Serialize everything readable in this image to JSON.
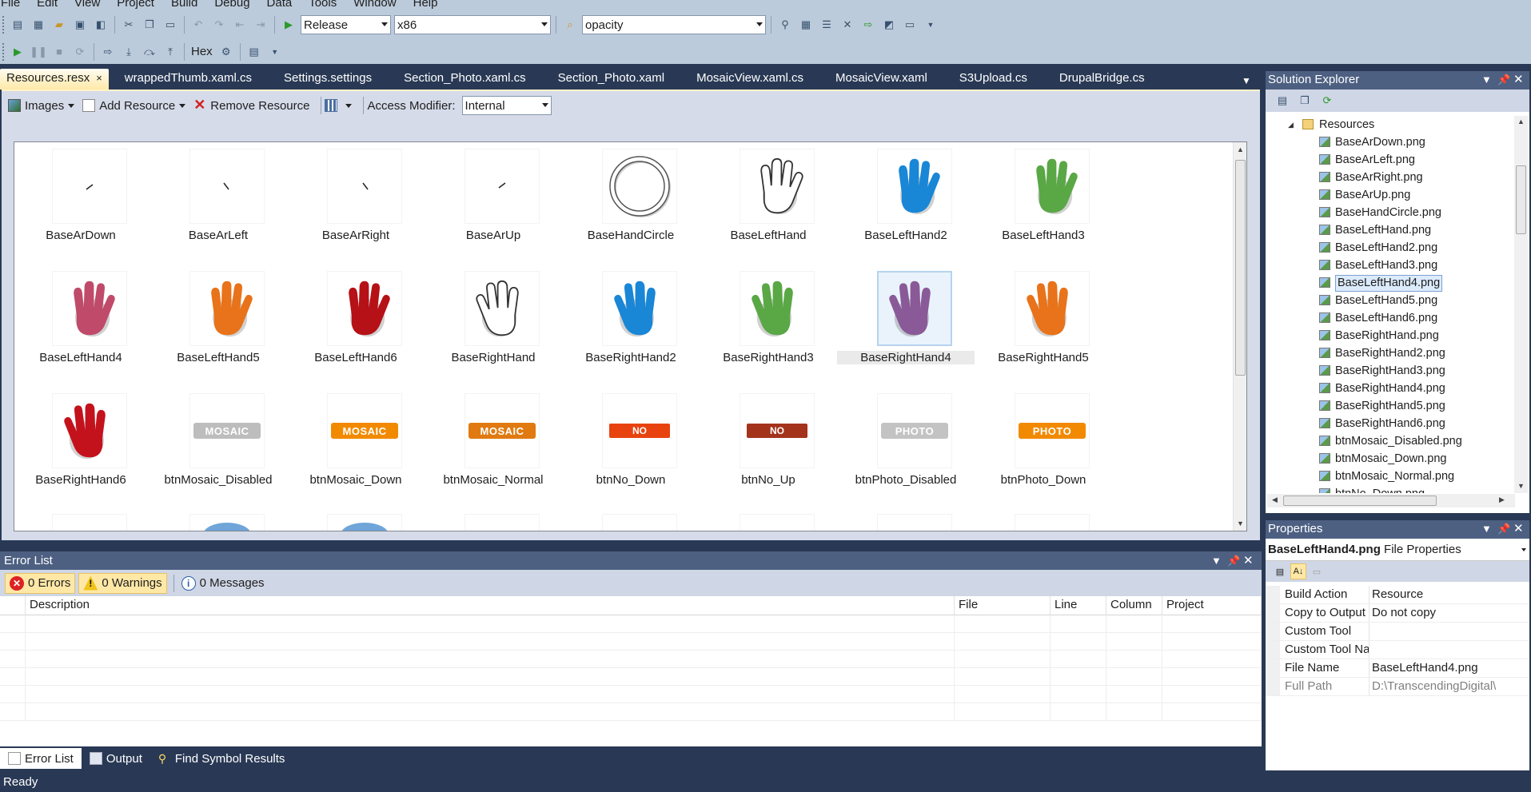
{
  "menu": [
    "File",
    "Edit",
    "View",
    "Project",
    "Build",
    "Debug",
    "Data",
    "Tools",
    "Window",
    "Help"
  ],
  "toolbar": {
    "config": "Release",
    "platform": "x86",
    "find": "opacity",
    "hex_label": "Hex"
  },
  "doc_tabs": [
    {
      "label": "Resources.resx",
      "active": true,
      "close": "×"
    },
    {
      "label": "wrappedThumb.xaml.cs"
    },
    {
      "label": "Settings.settings"
    },
    {
      "label": "Section_Photo.xaml.cs"
    },
    {
      "label": "Section_Photo.xaml"
    },
    {
      "label": "MosaicView.xaml.cs"
    },
    {
      "label": "MosaicView.xaml"
    },
    {
      "label": "S3Upload.cs"
    },
    {
      "label": "DrupalBridge.cs"
    }
  ],
  "resource_toolbar": {
    "images_label": "Images",
    "add_label": "Add Resource",
    "remove_label": "Remove Resource",
    "access_label": "Access Modifier:",
    "access_value": "Internal"
  },
  "resources": [
    {
      "name": "BaseArDown",
      "kind": "arrow",
      "dir": "down"
    },
    {
      "name": "BaseArLeft",
      "kind": "arrow",
      "dir": "left"
    },
    {
      "name": "BaseArRight",
      "kind": "arrow",
      "dir": "right"
    },
    {
      "name": "BaseArUp",
      "kind": "arrow",
      "dir": "up"
    },
    {
      "name": "BaseHandCircle",
      "kind": "circle"
    },
    {
      "name": "BaseLeftHand",
      "kind": "hand",
      "color": "#ffffff",
      "side": "left"
    },
    {
      "name": "BaseLeftHand2",
      "kind": "hand",
      "color": "#1a86d6",
      "side": "left"
    },
    {
      "name": "BaseLeftHand3",
      "kind": "hand",
      "color": "#5aa746",
      "side": "left"
    },
    {
      "name": "BaseLeftHand4",
      "kind": "hand",
      "color": "#c04a6a",
      "side": "left"
    },
    {
      "name": "BaseLeftHand5",
      "kind": "hand",
      "color": "#e8731a",
      "side": "left"
    },
    {
      "name": "BaseLeftHand6",
      "kind": "hand",
      "color": "#b51116",
      "side": "left"
    },
    {
      "name": "BaseRightHand",
      "kind": "hand",
      "color": "#ffffff",
      "side": "right"
    },
    {
      "name": "BaseRightHand2",
      "kind": "hand",
      "color": "#1a86d6",
      "side": "right"
    },
    {
      "name": "BaseRightHand3",
      "kind": "hand",
      "color": "#5aa746",
      "side": "right"
    },
    {
      "name": "BaseRightHand4",
      "kind": "hand",
      "color": "#8a5a98",
      "side": "right",
      "selected": true
    },
    {
      "name": "BaseRightHand5",
      "kind": "hand",
      "color": "#e8731a",
      "side": "right"
    },
    {
      "name": "BaseRightHand6",
      "kind": "hand",
      "color": "#c4121c",
      "side": "right"
    },
    {
      "name": "btnMosaic_Disabled",
      "kind": "badge",
      "text": "MOSAIC",
      "color": "#bdbdbd"
    },
    {
      "name": "btnMosaic_Down",
      "kind": "badge",
      "text": "MOSAIC",
      "color": "#f28a00"
    },
    {
      "name": "btnMosaic_Normal",
      "kind": "badge",
      "text": "MOSAIC",
      "color": "#e07a10"
    },
    {
      "name": "btnNo_Down",
      "kind": "no",
      "text": "NO",
      "color": "#e8430f"
    },
    {
      "name": "btnNo_Up",
      "kind": "no",
      "text": "NO",
      "color": "#a3331b"
    },
    {
      "name": "btnPhoto_Disabled",
      "kind": "badge",
      "text": "PHOTO",
      "color": "#c3c3c3"
    },
    {
      "name": "btnPhoto_Down",
      "kind": "badge",
      "text": "PHOTO",
      "color": "#f28a00"
    }
  ],
  "error_list": {
    "title": "Error List",
    "errors": "0 Errors",
    "warnings": "0 Warnings",
    "messages": "0 Messages",
    "columns": [
      "",
      "Description",
      "File",
      "Line",
      "Column",
      "Project"
    ]
  },
  "bottom_tabs": [
    "Error List",
    "Output",
    "Find Symbol Results"
  ],
  "status": "Ready",
  "solution_explorer": {
    "title": "Solution Explorer",
    "folder": "Resources",
    "files": [
      "BaseArDown.png",
      "BaseArLeft.png",
      "BaseArRight.png",
      "BaseArUp.png",
      "BaseHandCircle.png",
      "BaseLeftHand.png",
      "BaseLeftHand2.png",
      "BaseLeftHand3.png",
      "BaseLeftHand4.png",
      "BaseLeftHand5.png",
      "BaseLeftHand6.png",
      "BaseRightHand.png",
      "BaseRightHand2.png",
      "BaseRightHand3.png",
      "BaseRightHand4.png",
      "BaseRightHand5.png",
      "BaseRightHand6.png",
      "btnMosaic_Disabled.png",
      "btnMosaic_Down.png",
      "btnMosaic_Normal.png",
      "btnNo_Down.png"
    ],
    "selected": "BaseLeftHand4.png"
  },
  "properties": {
    "title": "Properties",
    "object_name": "BaseLeftHand4.png",
    "object_type": "File Properties",
    "rows": [
      {
        "name": "Build Action",
        "value": "Resource"
      },
      {
        "name": "Copy to Output Dire",
        "value": "Do not copy"
      },
      {
        "name": "Custom Tool",
        "value": ""
      },
      {
        "name": "Custom Tool Name",
        "value": ""
      },
      {
        "name": "File Name",
        "value": "BaseLeftHand4.png"
      },
      {
        "name": "Full Path",
        "value": "D:\\TranscendingDigital\\",
        "readonly": true
      }
    ]
  }
}
